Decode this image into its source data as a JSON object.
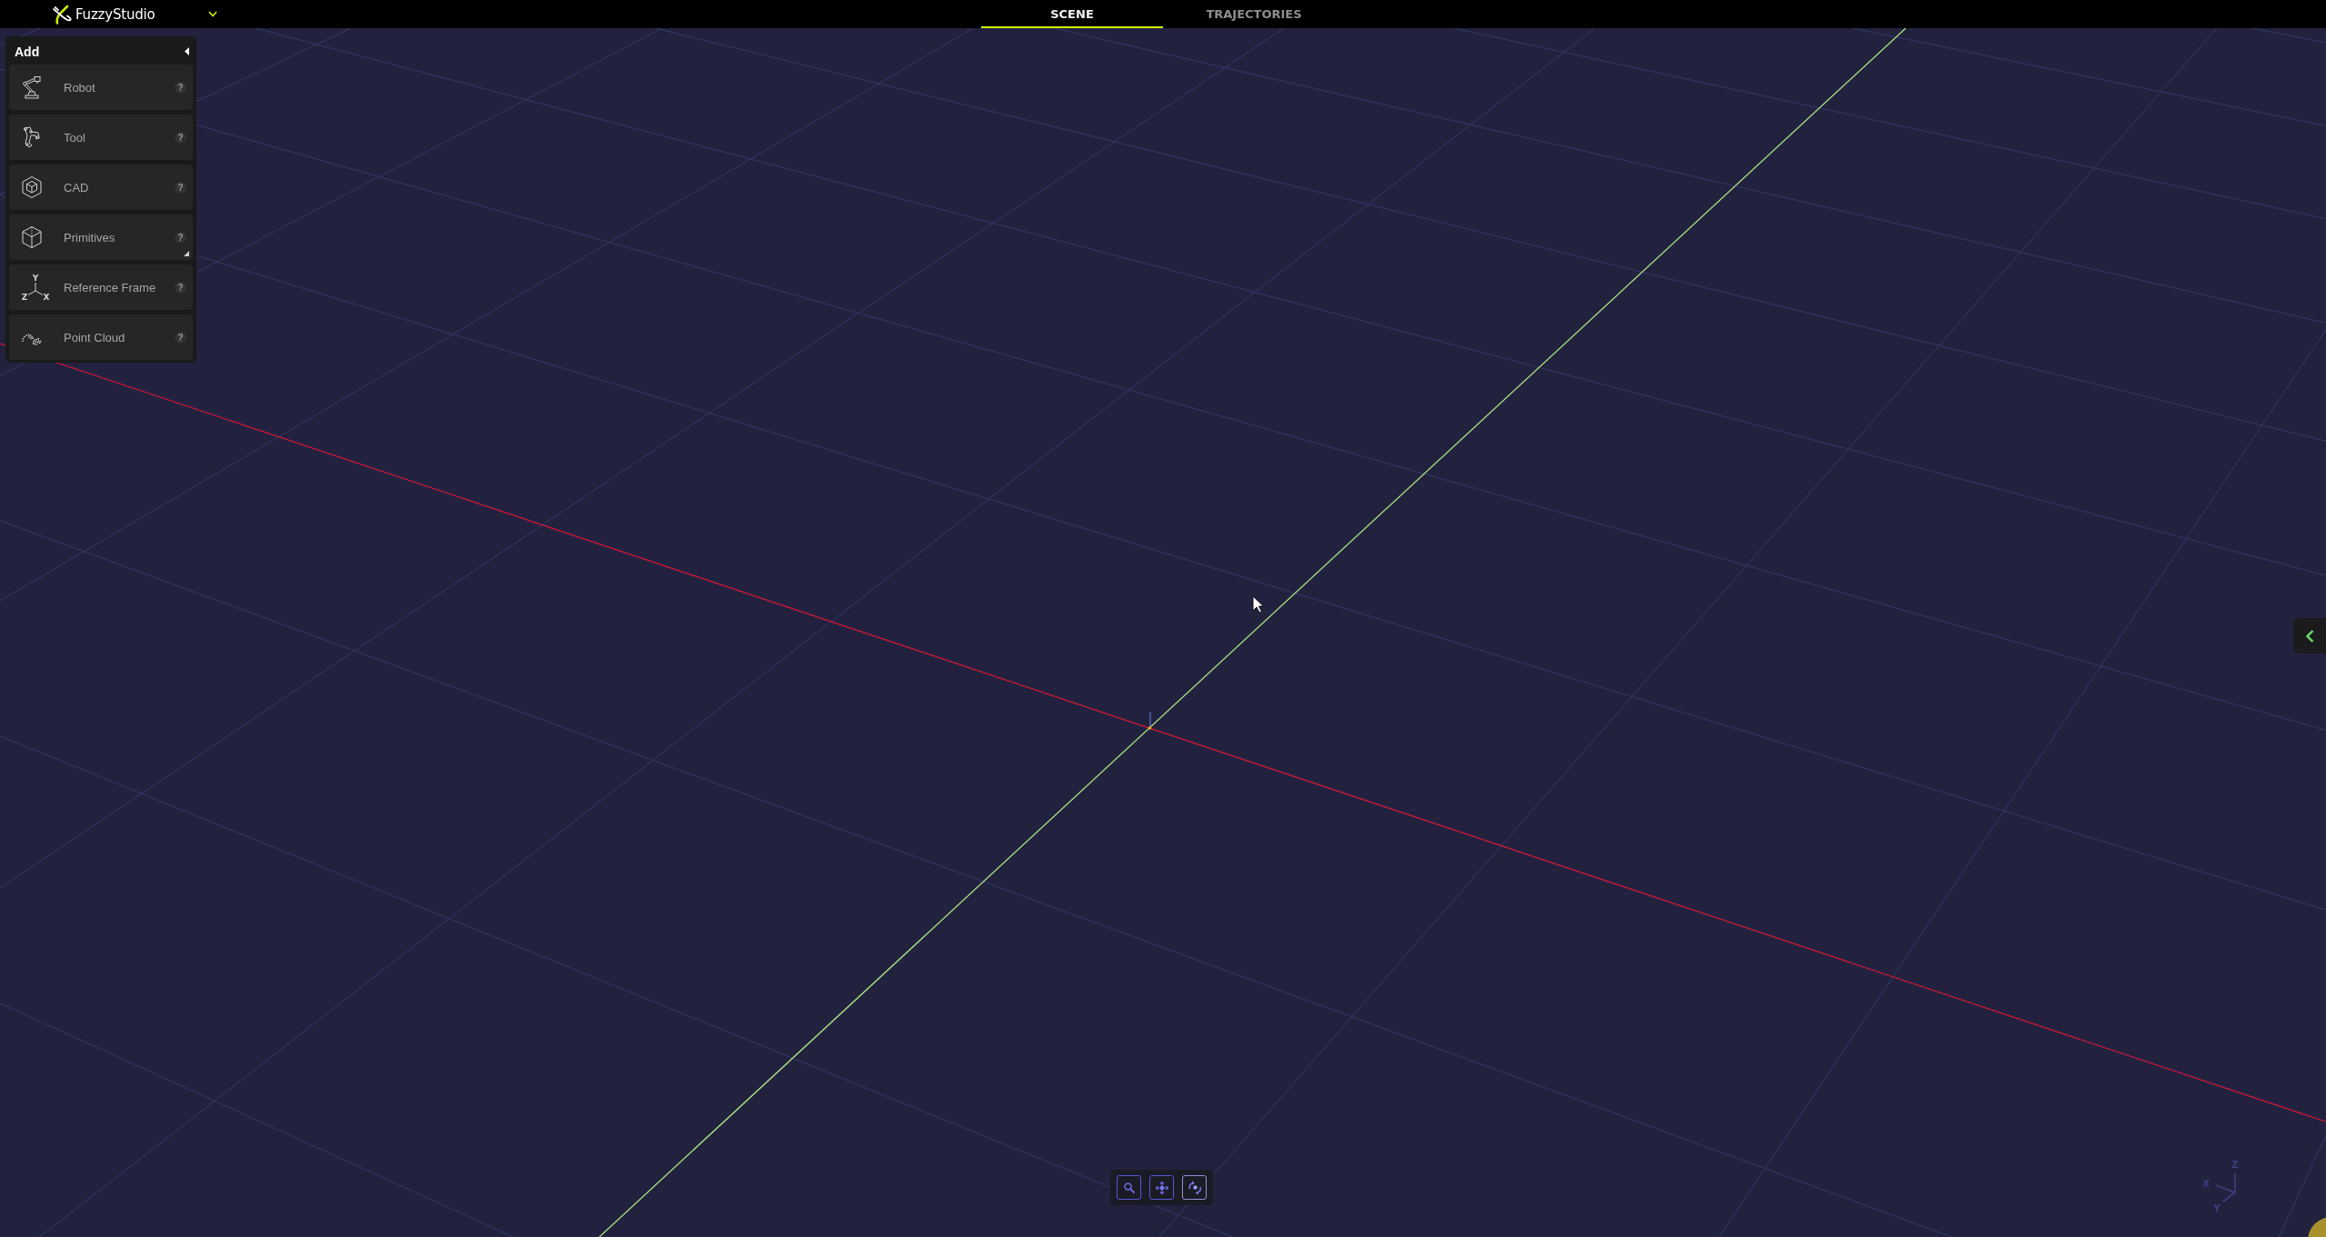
{
  "header": {
    "app_name": "FuzzyStudio"
  },
  "tabs": [
    {
      "label": "SCENE",
      "selected": true
    },
    {
      "label": "TRAJECTORIES",
      "selected": false
    }
  ],
  "add_panel": {
    "title": "Add",
    "expanded": true,
    "items": [
      {
        "kind": "robot",
        "label": "Robot",
        "help": "?",
        "submenu": false
      },
      {
        "kind": "tool",
        "label": "Tool",
        "help": "?",
        "submenu": false
      },
      {
        "kind": "cad",
        "label": "CAD",
        "help": "?",
        "submenu": false
      },
      {
        "kind": "primitives",
        "label": "Primitives",
        "help": "?",
        "submenu": true
      },
      {
        "kind": "frame",
        "label": "Reference Frame",
        "help": "?",
        "submenu": false,
        "icon_labels": [
          "Y",
          "Z",
          "X"
        ]
      },
      {
        "kind": "pointcloud",
        "label": "Point Cloud",
        "help": "?",
        "submenu": false
      }
    ]
  },
  "view_tools": [
    {
      "kind": "zoom",
      "selected": false
    },
    {
      "kind": "pan",
      "selected": false
    },
    {
      "kind": "orbit",
      "selected": true
    }
  ],
  "axes_gizmo": {
    "labels": [
      "Z",
      "X",
      "Y"
    ]
  }
}
